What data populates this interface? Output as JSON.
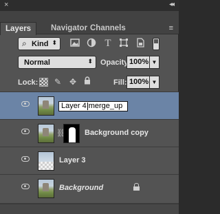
{
  "titlebar": {
    "close": "×",
    "collapse": "◂◂"
  },
  "tabs": [
    {
      "label": "Layers",
      "active": true
    },
    {
      "label": "Navigator",
      "active": false
    },
    {
      "label": "Channels",
      "active": false
    }
  ],
  "panel_menu_icon": "≡",
  "filter": {
    "kind_label": "Kind",
    "icons": [
      "image-filter-icon",
      "adjustment-filter-icon",
      "type-filter-icon",
      "shape-filter-icon",
      "smart-object-filter-icon"
    ]
  },
  "blend": {
    "mode": "Normal",
    "opacity_label": "Opacity:",
    "opacity": "100%"
  },
  "lock": {
    "label": "Lock:",
    "fill_label": "Fill:",
    "fill": "100%"
  },
  "layers": [
    {
      "name": "Layer 4",
      "rename_prefix": "Layer 4",
      "rename_suffix": "merge_up",
      "selected": true,
      "editing": true
    },
    {
      "name": "Background copy",
      "has_mask": true
    },
    {
      "name": "Layer 3"
    },
    {
      "name": "Background",
      "locked": true
    }
  ],
  "colors": {
    "selected_row": "#6b84a6",
    "panel_bg": "#535353"
  }
}
